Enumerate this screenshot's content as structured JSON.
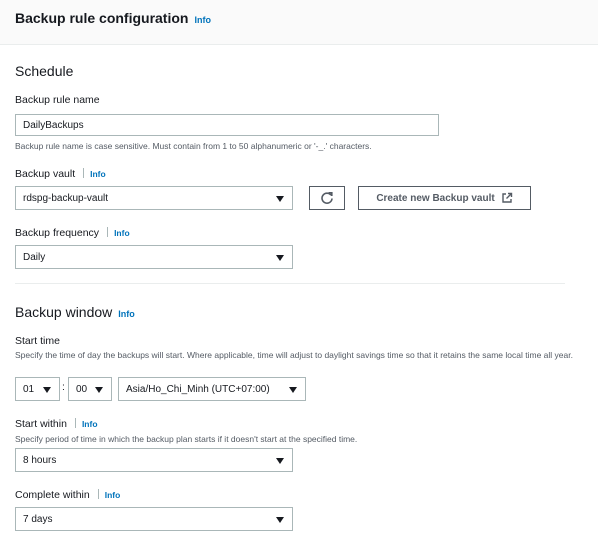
{
  "header": {
    "title": "Backup rule configuration",
    "info": "Info"
  },
  "schedule": {
    "title": "Schedule",
    "rule_name": {
      "label": "Backup rule name",
      "value": "DailyBackups",
      "hint": "Backup rule name is case sensitive. Must contain from 1 to 50 alphanumeric or '-_.' characters."
    },
    "vault": {
      "label": "Backup vault",
      "info": "Info",
      "value": "rdspg-backup-vault",
      "create_button": "Create new Backup vault"
    },
    "frequency": {
      "label": "Backup frequency",
      "info": "Info",
      "value": "Daily"
    }
  },
  "window": {
    "title": "Backup window",
    "info": "Info",
    "start_time": {
      "label": "Start time",
      "hint": "Specify the time of day the backups will start. Where applicable, time will adjust to daylight savings time so that it retains the same local time all year.",
      "hour": "01",
      "colon": ":",
      "minute": "00",
      "timezone": "Asia/Ho_Chi_Minh (UTC+07:00)"
    },
    "start_within": {
      "label": "Start within",
      "info": "Info",
      "hint": "Specify period of time in which the backup plan starts if it doesn't start at the specified time.",
      "value": "8 hours"
    },
    "complete_within": {
      "label": "Complete within",
      "info": "Info",
      "value": "7 days"
    }
  },
  "icons": {
    "refresh": "refresh-icon",
    "external": "external-link-icon",
    "caret": "caret-down-icon"
  }
}
